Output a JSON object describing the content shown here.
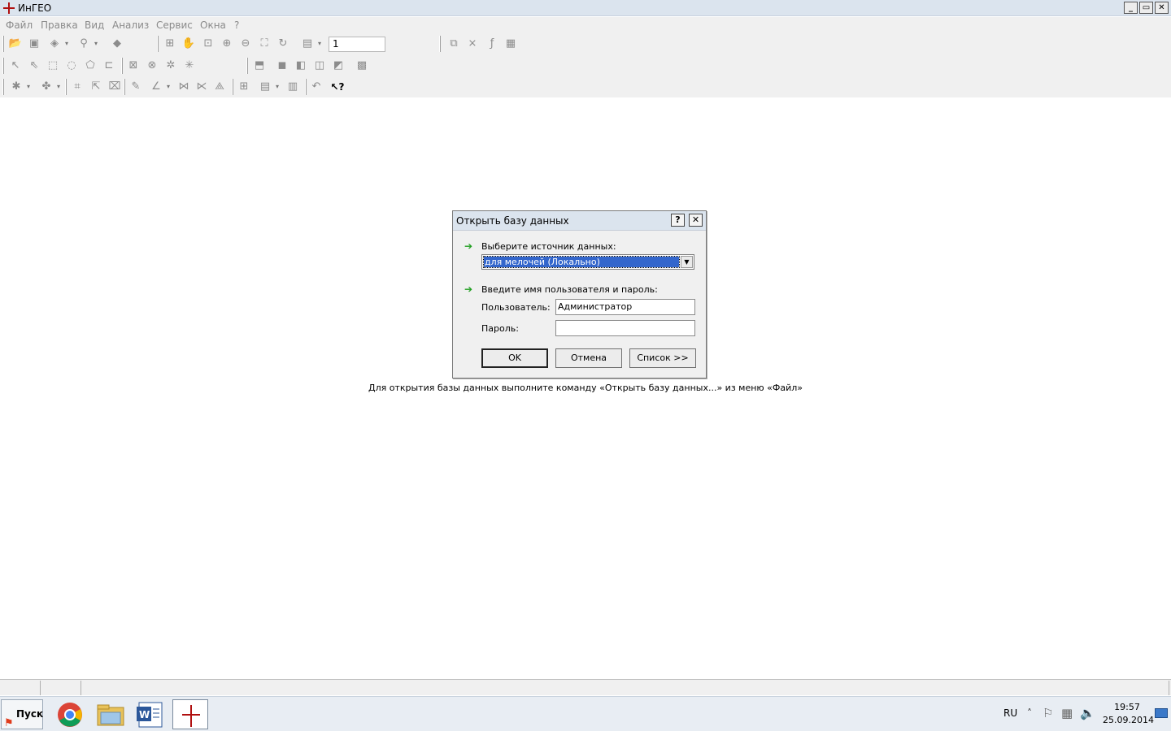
{
  "window": {
    "title": "ИнГЕО",
    "min": "_",
    "restore": "▭",
    "close": "✕"
  },
  "menu": [
    "Файл",
    "Правка",
    "Вид",
    "Анализ",
    "Сервис",
    "Окна",
    "?"
  ],
  "toolbar": {
    "page_value": "1"
  },
  "dialog": {
    "title": "Открыть базу данных",
    "help": "?",
    "close": "✕",
    "source_label": "Выберите источник данных:",
    "source_value": "для мелочей (Локально)",
    "cred_label": "Введите имя пользователя и пароль:",
    "user_label": "Пользователь:",
    "user_value": "Администратор",
    "password_label": "Пароль:",
    "password_value": "",
    "ok": "OK",
    "cancel": "Отмена",
    "list": "Список >>"
  },
  "hint": "Для открытия базы данных выполните команду «Открыть базу данных...» из меню «Файл»",
  "taskbar": {
    "start": "Пуск",
    "lang": "RU",
    "time": "19:57",
    "date": "25.09.2014"
  },
  "colors": {
    "accent": "#3366cc",
    "arrow": "#22a022",
    "logo": "#cc1111"
  }
}
